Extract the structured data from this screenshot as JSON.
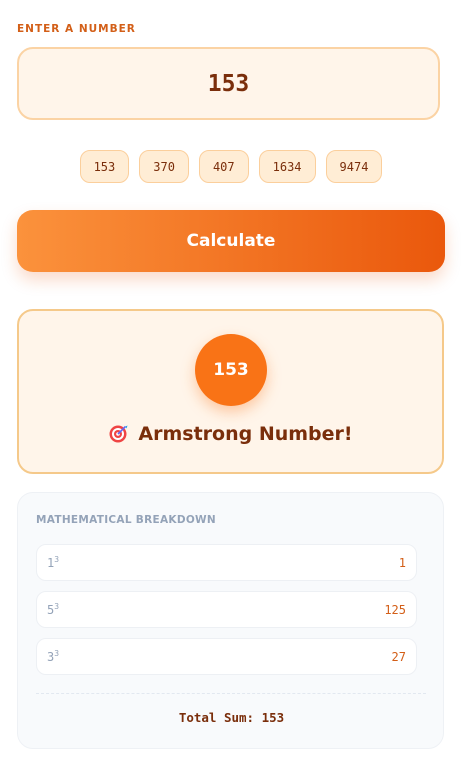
{
  "input": {
    "label": "ENTER A NUMBER",
    "value": "153"
  },
  "presets": [
    "153",
    "370",
    "407",
    "1634",
    "9474"
  ],
  "calculate_label": "Calculate",
  "result": {
    "number": "153",
    "verdict": "Armstrong Number!",
    "icon": "target-dart-icon"
  },
  "breakdown": {
    "title": "MATHEMATICAL BREAKDOWN",
    "rows": [
      {
        "base": "1",
        "exp": "3",
        "value": "1"
      },
      {
        "base": "5",
        "exp": "3",
        "value": "125"
      },
      {
        "base": "3",
        "exp": "3",
        "value": "27"
      }
    ],
    "total": "Total Sum: 153"
  },
  "colors": {
    "accent": "#f97316",
    "accent_dark": "#ea580c",
    "text_dark": "#7a2e0b",
    "card_bg": "#fff5ea"
  }
}
